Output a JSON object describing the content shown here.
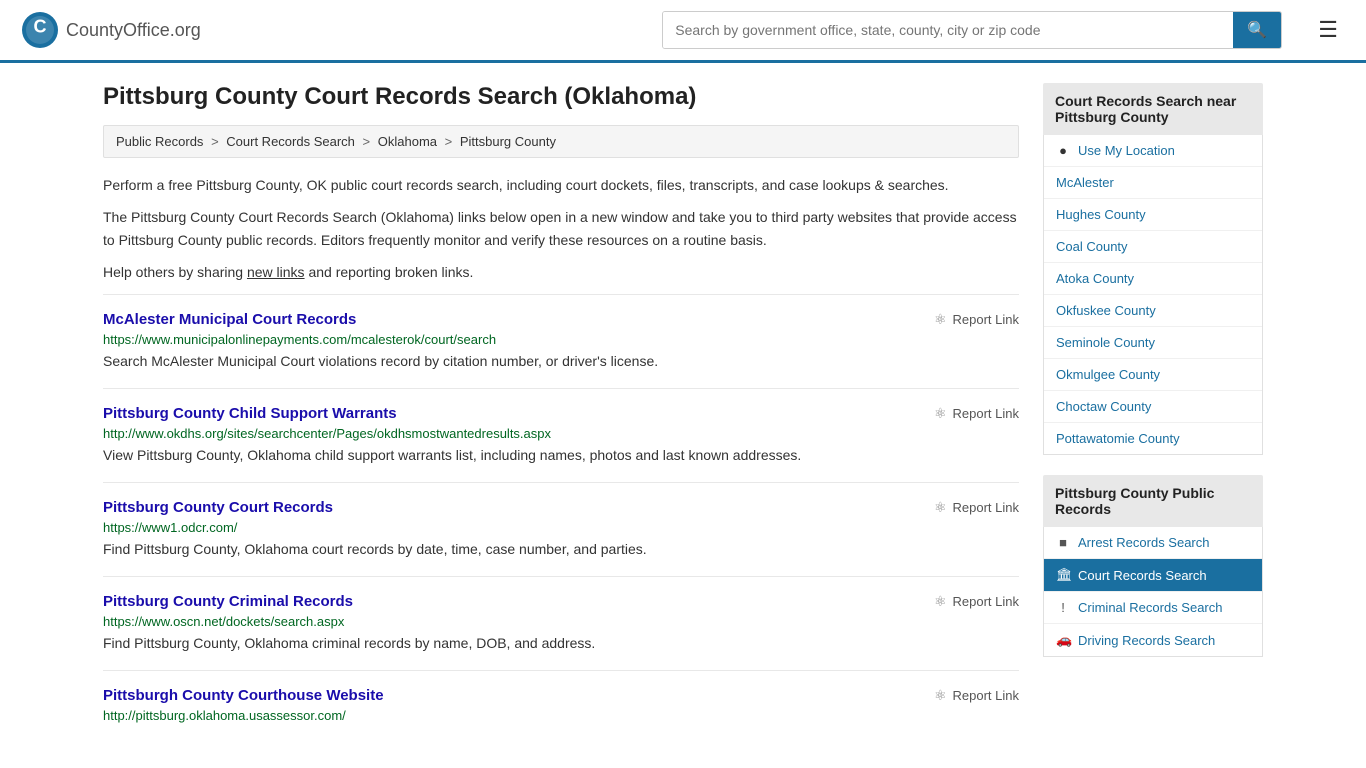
{
  "header": {
    "logo_text": "CountyOffice",
    "logo_suffix": ".org",
    "search_placeholder": "Search by government office, state, county, city or zip code",
    "search_value": ""
  },
  "page": {
    "title": "Pittsburg County Court Records Search (Oklahoma)",
    "breadcrumbs": [
      {
        "label": "Public Records",
        "href": "#"
      },
      {
        "label": "Court Records Search",
        "href": "#"
      },
      {
        "label": "Oklahoma",
        "href": "#"
      },
      {
        "label": "Pittsburg County",
        "href": "#"
      }
    ],
    "description1": "Perform a free Pittsburg County, OK public court records search, including court dockets, files, transcripts, and case lookups & searches.",
    "description2": "The Pittsburg County Court Records Search (Oklahoma) links below open in a new window and take you to third party websites that provide access to Pittsburg County public records. Editors frequently monitor and verify these resources on a routine basis.",
    "description3_pre": "Help others by sharing ",
    "description3_link": "new links",
    "description3_post": " and reporting broken links."
  },
  "records": [
    {
      "title": "McAlester Municipal Court Records",
      "url": "https://www.municipalonlinepayments.com/mcalesterok/court/search",
      "description": "Search McAlester Municipal Court violations record by citation number, or driver's license.",
      "report_label": "Report Link"
    },
    {
      "title": "Pittsburg County Child Support Warrants",
      "url": "http://www.okdhs.org/sites/searchcenter/Pages/okdhsmostwantedresults.aspx",
      "description": "View Pittsburg County, Oklahoma child support warrants list, including names, photos and last known addresses.",
      "report_label": "Report Link"
    },
    {
      "title": "Pittsburg County Court Records",
      "url": "https://www1.odcr.com/",
      "description": "Find Pittsburg County, Oklahoma court records by date, time, case number, and parties.",
      "report_label": "Report Link"
    },
    {
      "title": "Pittsburg County Criminal Records",
      "url": "https://www.oscn.net/dockets/search.aspx",
      "description": "Find Pittsburg County, Oklahoma criminal records by name, DOB, and address.",
      "report_label": "Report Link"
    },
    {
      "title": "Pittsburgh County Courthouse Website",
      "url": "http://pittsburg.oklahoma.usassessor.com/",
      "description": "",
      "report_label": "Report Link"
    }
  ],
  "sidebar": {
    "nearby_title": "Court Records Search near Pittsburg County",
    "nearby_links": [
      {
        "label": "Use My Location",
        "icon": "location",
        "href": "#"
      },
      {
        "label": "McAlester",
        "icon": "",
        "href": "#"
      },
      {
        "label": "Hughes County",
        "icon": "",
        "href": "#"
      },
      {
        "label": "Coal County",
        "icon": "",
        "href": "#"
      },
      {
        "label": "Atoka County",
        "icon": "",
        "href": "#"
      },
      {
        "label": "Okfuskee County",
        "icon": "",
        "href": "#"
      },
      {
        "label": "Seminole County",
        "icon": "",
        "href": "#"
      },
      {
        "label": "Okmulgee County",
        "icon": "",
        "href": "#"
      },
      {
        "label": "Choctaw County",
        "icon": "",
        "href": "#"
      },
      {
        "label": "Pottawatomie County",
        "icon": "",
        "href": "#"
      }
    ],
    "public_records_title": "Pittsburg County Public Records",
    "public_records_links": [
      {
        "label": "Arrest Records Search",
        "icon": "square",
        "href": "#",
        "active": false
      },
      {
        "label": "Court Records Search",
        "icon": "building",
        "href": "#",
        "active": true
      },
      {
        "label": "Criminal Records Search",
        "icon": "exclamation",
        "href": "#",
        "active": false
      },
      {
        "label": "Driving Records Search",
        "icon": "car",
        "href": "#",
        "active": false
      }
    ]
  }
}
